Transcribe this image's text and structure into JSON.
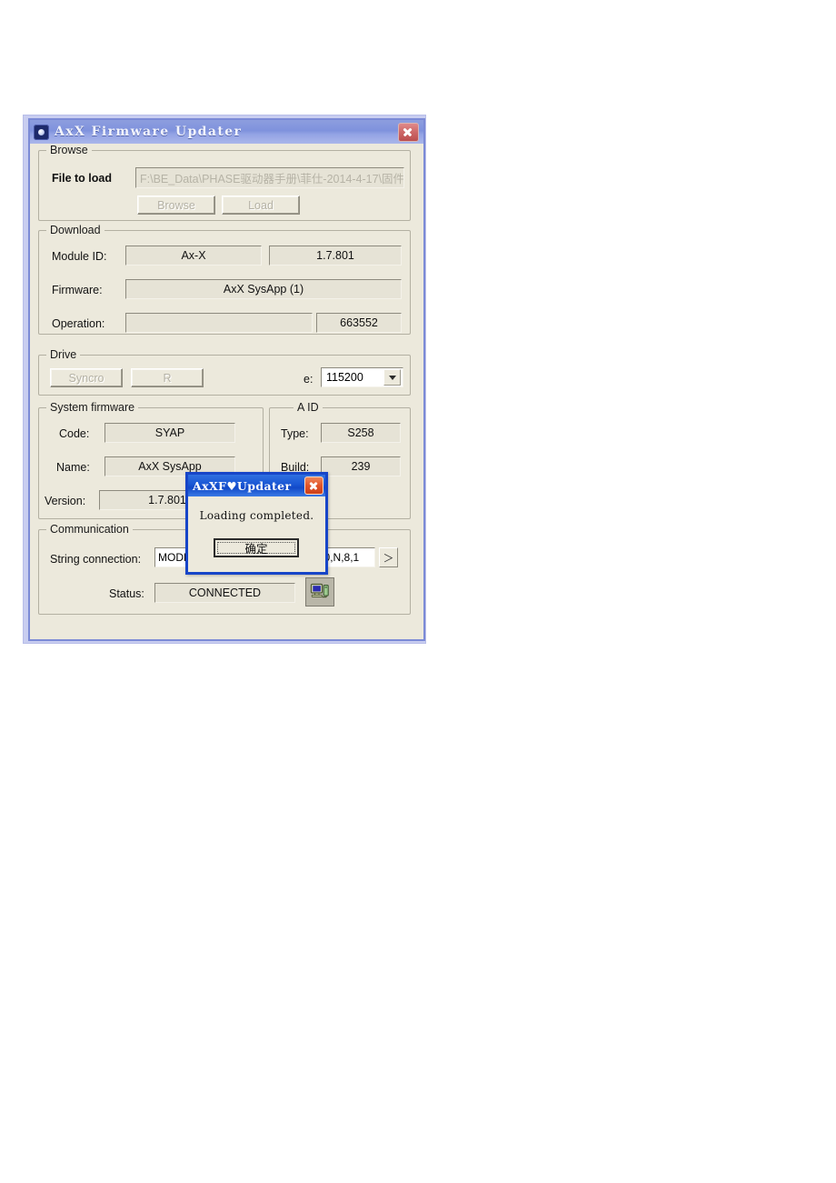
{
  "window": {
    "title": "AxX Firmware Updater",
    "icon": "app-gear-icon",
    "close_label": "✕"
  },
  "browse": {
    "group_title": "Browse",
    "file_label": "File to load",
    "file_value": "F:\\BE_Data\\PHASE驱动器手册\\菲仕-2014-4-17\\固件",
    "browse_button": "Browse",
    "load_button": "Load"
  },
  "download": {
    "group_title": "Download",
    "module_id_label": "Module ID:",
    "module_id_value": "Ax-X",
    "module_version_value": "1.7.801",
    "firmware_label": "Firmware:",
    "firmware_value": "AxX SysApp (1)",
    "operation_label": "Operation:",
    "operation_value": "",
    "operation_size_value": "663552"
  },
  "drive": {
    "group_title": "Drive",
    "syncro_button": "Syncro",
    "reset_button": "R",
    "rate_label": "e:",
    "baud_value": "115200"
  },
  "system_firmware": {
    "group_title": "System firmware",
    "code_label": "Code:",
    "code_value": "SYAP",
    "name_label": "Name:",
    "name_value": "AxX SysApp",
    "version_label": "Version:",
    "version_value": "1.7.801"
  },
  "fpga": {
    "group_title": "A ID",
    "type_label": "Type:",
    "type_value": "S258",
    "build_label": "Build:",
    "build_value": "239"
  },
  "communication": {
    "group_title": "Communication",
    "string_label": "String connection:",
    "string_value": "MODBUS:1,1000,J#COM:5,115200,N,8,1",
    "more_button": "＞",
    "status_label": "Status:",
    "status_value": "CONNECTED",
    "status_icon": "network-computer-icon"
  },
  "dialog": {
    "title": "AxXF♥Updater",
    "message": "Loading completed.",
    "ok_button": "确定",
    "close_label": "✕"
  },
  "colors": {
    "title_bar": "#7f92dd",
    "dialog_border": "#1745c8",
    "dialog_title_bar": "#1a56d4",
    "window_face": "#ece9dc",
    "frame": "#c8cdf0"
  }
}
